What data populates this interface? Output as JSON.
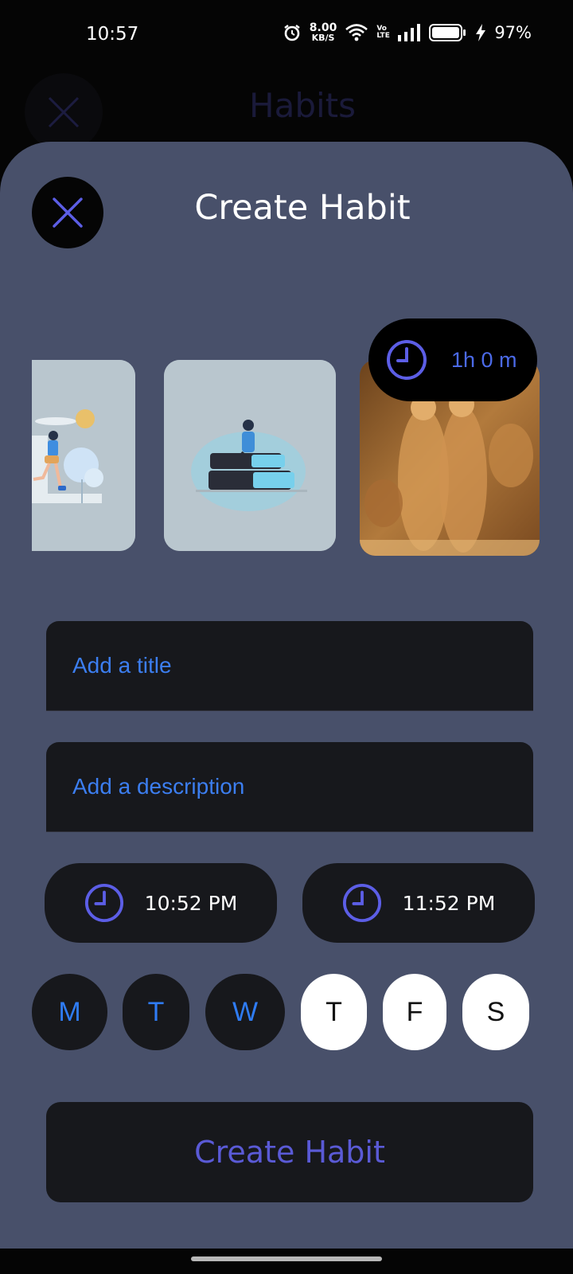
{
  "status_bar": {
    "time": "10:57",
    "net_speed_value": "8.00",
    "net_speed_unit": "KB/S",
    "battery_percent": "97%",
    "volte": "Vo LTE"
  },
  "background": {
    "title": "Habits"
  },
  "sheet": {
    "title": "Create Habit",
    "duration": "1h 0 m",
    "title_placeholder": "Add a title",
    "description_placeholder": "Add a description",
    "start_time": "10:52 PM",
    "end_time": "11:52 PM",
    "days": [
      {
        "label": "M",
        "selected": true
      },
      {
        "label": "T",
        "selected": true
      },
      {
        "label": "W",
        "selected": true
      },
      {
        "label": "T",
        "selected": false
      },
      {
        "label": "F",
        "selected": false
      },
      {
        "label": "S",
        "selected": false
      }
    ],
    "submit_label": "Create Habit",
    "images": [
      "running-illustration",
      "reading-illustration",
      "wood-carving-photo"
    ]
  },
  "colors": {
    "sheet_bg": "#48506a",
    "field_bg": "#17181c",
    "accent_blue": "#3c7ef0",
    "accent_purple": "#5a5ad6"
  }
}
